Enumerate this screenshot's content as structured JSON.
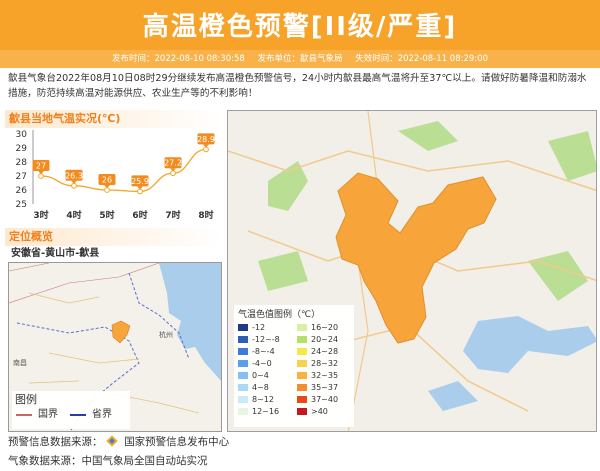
{
  "header": {
    "title": "高温橙色预警[II级/严重]",
    "publish_time": "发布时间：2022-08-10 08:30:58",
    "publisher": "发布单位：歙县气象局",
    "expire_time": "失效时间：2022-08-11 08:29:00"
  },
  "description": "歙县气象台2022年08月10日08时29分继续发布高温橙色预警信号，24小时内歙县最高气温将升至37℃以上。请做好防暑降温和防溺水措施，防范持续高温对能源供应、农业生产等的不利影响！",
  "temp_section": {
    "title": "歙县当地气温实况(℃)"
  },
  "chart_data": {
    "type": "line",
    "title": "歙县当地气温实况(℃)",
    "categories": [
      "3时",
      "4时",
      "5时",
      "6时",
      "7时",
      "8时"
    ],
    "values": [
      27,
      26.3,
      26,
      25.9,
      27.2,
      28.9
    ],
    "yticks": [
      25,
      26,
      27,
      28,
      29,
      30
    ],
    "ylim": [
      25,
      30
    ],
    "grid": false,
    "line_color": "#f5a623",
    "label_bg": "#f28c1e"
  },
  "location": {
    "title": "定位概览",
    "name": "安徽省-黄山市-歙县",
    "legend_title": "图例",
    "legend_items": [
      "国界",
      "省界"
    ],
    "places": [
      "南昌",
      "杭州"
    ]
  },
  "map_legend": {
    "title": "气温色值图例（℃）",
    "items": [
      {
        "label": "-12",
        "color": "#1f3a8a"
      },
      {
        "label": "16~20",
        "color": "#d9f0a3"
      },
      {
        "label": "-12~-8",
        "color": "#2c5fb6"
      },
      {
        "label": "20~24",
        "color": "#b7e06a"
      },
      {
        "label": "-8~-4",
        "color": "#3b7dd8"
      },
      {
        "label": "24~28",
        "color": "#f5e94a"
      },
      {
        "label": "-4~0",
        "color": "#5b9ee9"
      },
      {
        "label": "28~32",
        "color": "#f7d34c"
      },
      {
        "label": "0~4",
        "color": "#84c1f2"
      },
      {
        "label": "32~35",
        "color": "#f9b23f"
      },
      {
        "label": "4~8",
        "color": "#a9d9f7"
      },
      {
        "label": "35~37",
        "color": "#f38d2d"
      },
      {
        "label": "8~12",
        "color": "#c9eaf9"
      },
      {
        "label": "37~40",
        "color": "#e64a19"
      },
      {
        "label": "12~16",
        "color": "#e6f6df"
      },
      {
        "label": ">40",
        "color": "#c4171f"
      }
    ]
  },
  "footer": {
    "warning_source": "预警信息数据来源：",
    "warning_source_name": "国家预警信息发布中心",
    "weather_source": "气象数据来源：中国气象局全国自动站实况"
  },
  "colors": {
    "banner": "#f7a229",
    "meta_bar": "#f9b14a",
    "region": "#f7a53a",
    "water": "#a9cdea",
    "green": "#b5dc8c"
  }
}
